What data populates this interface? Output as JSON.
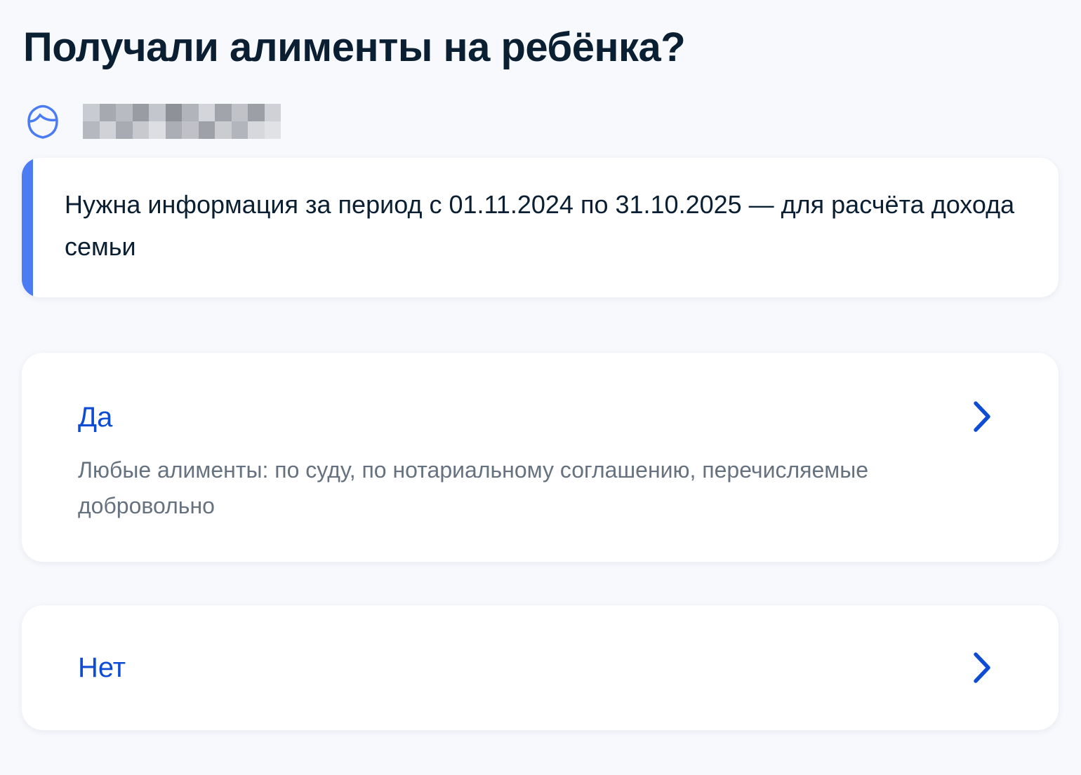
{
  "page": {
    "title": "Получали алименты на ребёнка?"
  },
  "child": {
    "icon": "child-face-icon",
    "name_redacted": true,
    "accent_color": "#4c7cf3"
  },
  "info": {
    "text": "Нужна информация за период с 01.11.2024 по 31.10.2025 — для расчёта дохода семьи",
    "accent_color": "#4c7cf3"
  },
  "options": [
    {
      "label": "Да",
      "description": "Любые алименты: по суду, по нотариальному соглашению, перечисляемые добровольно",
      "icon": "chevron-right-icon"
    },
    {
      "label": "Нет",
      "icon": "chevron-right-icon"
    }
  ],
  "colors": {
    "background": "#f8f9fd",
    "card": "#ffffff",
    "title": "#0b1f33",
    "link": "#0d4cd3",
    "secondary_text": "#66727f"
  }
}
